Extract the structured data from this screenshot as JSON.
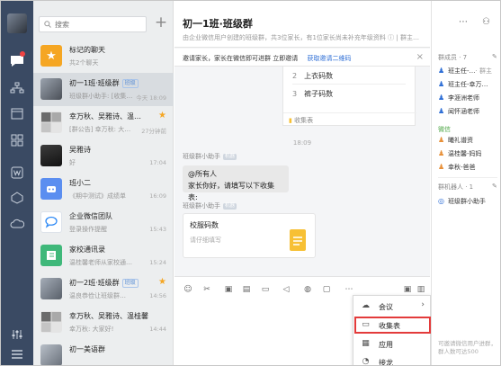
{
  "search": {
    "placeholder": "搜索"
  },
  "chats": [
    {
      "name": "标记的聊天",
      "sub": "共2个聊天",
      "time": "",
      "tag": "",
      "starred": false,
      "avatar": "star"
    },
    {
      "name": "初一1班·班级群",
      "sub": "班级群小助手: [收集…",
      "time": "今天 18:09",
      "tag": "班级",
      "starred": false,
      "avatar": "photo-a"
    },
    {
      "name": "幸万秋、吴雅诗、温…",
      "sub": "[群公告] 幸万秋: 大…",
      "time": "27分钟前",
      "tag": "",
      "starred": true,
      "avatar": "grid"
    },
    {
      "name": "吴雅诗",
      "sub": "好",
      "time": "17:04",
      "tag": "",
      "starred": false,
      "avatar": "photo-b"
    },
    {
      "name": "班小二",
      "sub": "《期中测试》成绩单",
      "time": "16:09",
      "tag": "",
      "starred": false,
      "avatar": "blue"
    },
    {
      "name": "企业微信团队",
      "sub": "登录操作提醒",
      "time": "15:43",
      "tag": "",
      "starred": false,
      "avatar": "wecom"
    },
    {
      "name": "家校通讯录",
      "sub": "温桂馨老师从家校通…",
      "time": "15:24",
      "tag": "",
      "starred": false,
      "avatar": "green"
    },
    {
      "name": "初一2班·班级群",
      "sub": "温良恭俭让班级群…",
      "time": "14:56",
      "tag": "班级",
      "starred": true,
      "avatar": "photo-c"
    },
    {
      "name": "幸万秋、吴雅诗、温桂馨",
      "sub": "幸万秋: 大家好!",
      "time": "14:44",
      "tag": "",
      "starred": false,
      "avatar": "grid"
    },
    {
      "name": "初一美语群",
      "sub": "",
      "time": "",
      "tag": "",
      "starred": false,
      "avatar": "photo-d"
    }
  ],
  "header": {
    "title": "初一1班·班级群",
    "subtitle": "由企业微信用户创建的班级群，共3位家长，有1位家长尚未补充年级资料 ⓘ | 群主…"
  },
  "notice": {
    "text": "邀请家长，家长在微信即可进群 立即邀请",
    "link": "获取邀请二维码"
  },
  "collect_card": {
    "items": [
      {
        "num": "2",
        "text": "上衣码数"
      },
      {
        "num": "3",
        "text": "裤子码数"
      }
    ],
    "footer": "收集表"
  },
  "messages": {
    "time": "18:09",
    "sender": "班级群小助手",
    "bot_tag": "机器",
    "bubble_line1": "@所有人",
    "bubble_line2": "家长你好，请填写以下收集表:",
    "card_title": "校服码数",
    "card_hint": "请仔细填写"
  },
  "menu": {
    "items": [
      {
        "label": "会议",
        "icon": "meeting-icon"
      },
      {
        "label": "收集表",
        "icon": "form-icon"
      },
      {
        "label": "应用",
        "icon": "apps-icon"
      },
      {
        "label": "接龙",
        "icon": "relay-icon"
      }
    ]
  },
  "members": {
    "heading": "群成员 · 7",
    "wework": [
      {
        "name": "班主任-…",
        "note": "· 群主"
      },
      {
        "name": "班主任-幸万…",
        "note": ""
      },
      {
        "name": "李涯洲老师",
        "note": ""
      },
      {
        "name": "闻怀涵老师",
        "note": ""
      }
    ],
    "wechat_label": "微信",
    "wechat": [
      {
        "name": "曦礼谱资"
      },
      {
        "name": "温桂馨-妈妈"
      },
      {
        "name": "幸秋-爸爸"
      }
    ],
    "bots_heading": "群机器人 · 1",
    "bots": [
      {
        "name": "班级群小助手"
      }
    ],
    "footer": "可邀请微信用户进群，群人数可达500"
  },
  "colors": {
    "nav": "#3a4a63",
    "accent": "#2f6fd6",
    "highlight": "#e33b3b"
  }
}
